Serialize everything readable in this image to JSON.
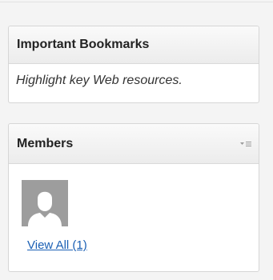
{
  "bookmarks_widget": {
    "title": "Important Bookmarks",
    "description": "Highlight key Web resources."
  },
  "members_widget": {
    "title": "Members",
    "menu_icon": "dropdown-menu-icon",
    "avatar_icon": "default-user-avatar",
    "view_all_label": "View All (1)"
  },
  "colors": {
    "background": "#f4f4f4",
    "link": "#1a5fb4",
    "avatar": "#9d9d9d"
  }
}
